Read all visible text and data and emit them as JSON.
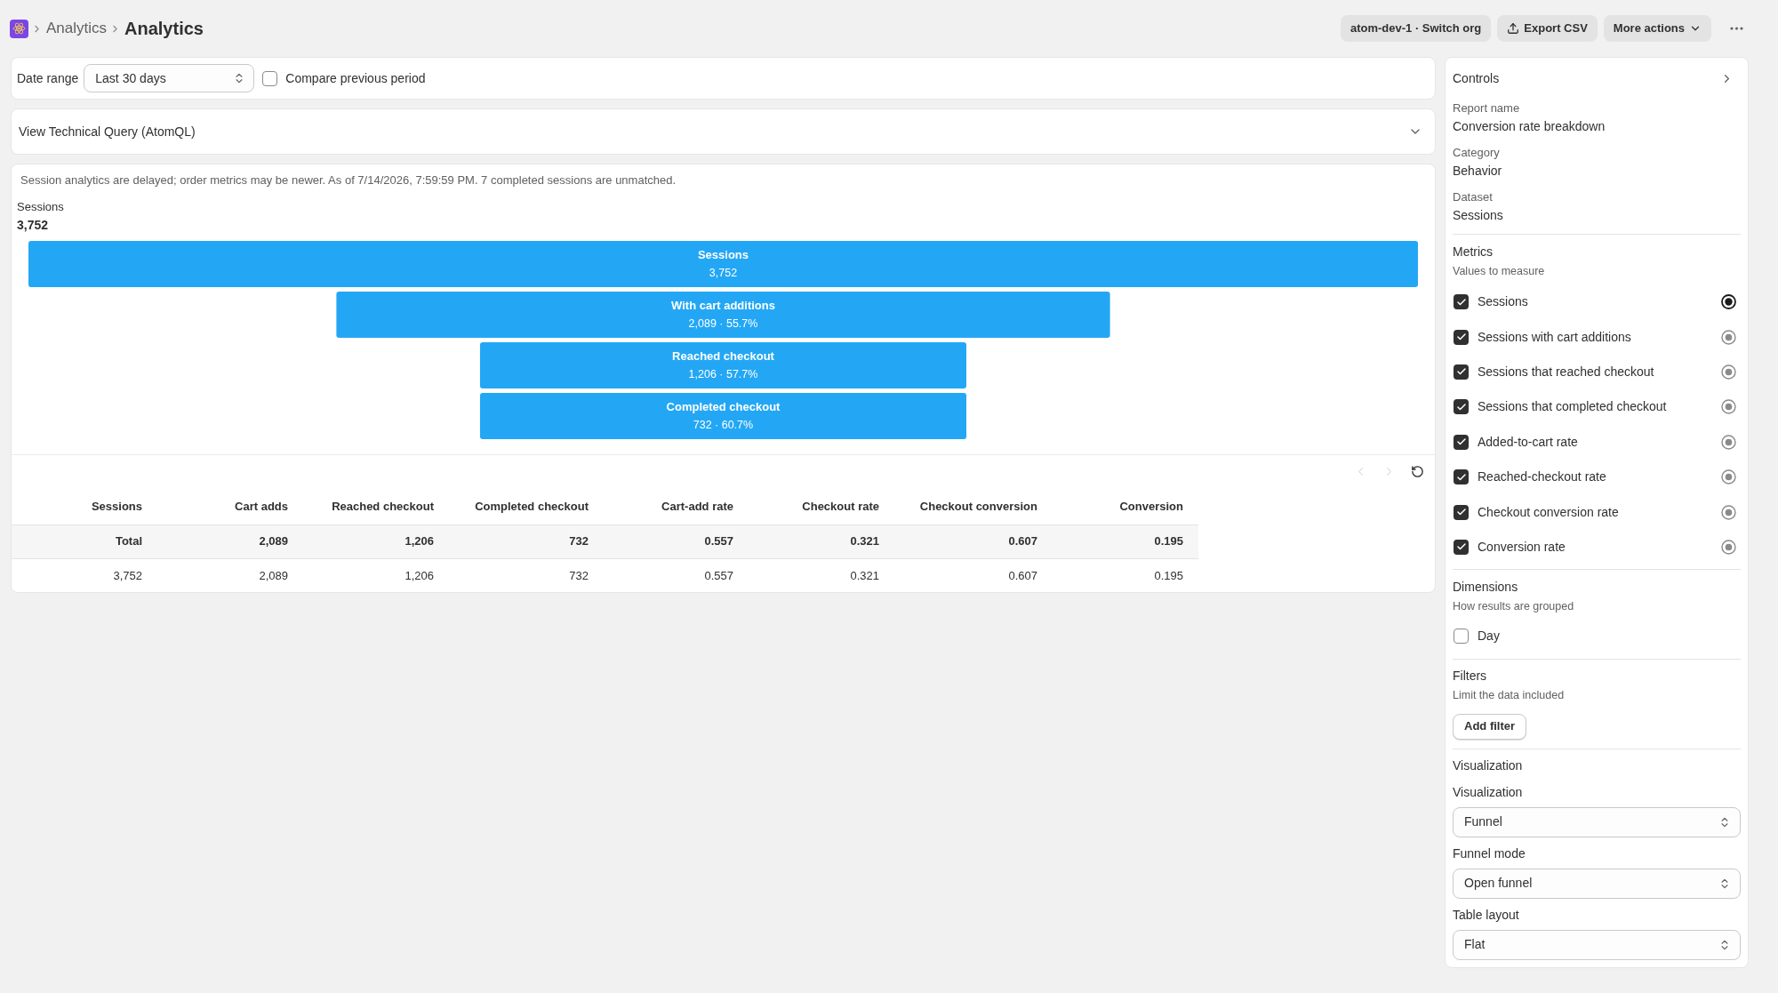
{
  "header": {
    "breadcrumbs": [
      "Analytics"
    ],
    "title": "Analytics",
    "actions": [
      {
        "label": "atom-dev-1 · Switch org",
        "kind": "plain"
      },
      {
        "label": "Export CSV",
        "kind": "export"
      },
      {
        "label": "More actions",
        "kind": "menu"
      }
    ]
  },
  "toolbar": {
    "date_range": {
      "label": "Date range",
      "value": "Last 30 days"
    },
    "compare": {
      "label": "Compare previous period",
      "checked": false
    }
  },
  "query": {
    "label": "View Technical Query (AtomQL)",
    "expanded": false
  },
  "report": {
    "notice": "Session analytics are delayed; order metrics may be newer. As of 7/14/2026, 7:59:59 PM. 7 completed sessions are unmatched.",
    "summary": {
      "label": "Sessions",
      "value": "3,752"
    },
    "chart_data": [
      {
        "type": "other",
        "categories": [
          "Sessions",
          "With cart additions",
          "Reached checkout",
          "Completed checkout"
        ],
        "values": [
          3752,
          2089,
          1206,
          732
        ],
        "value_labels": [
          "3,752",
          "2,089 · 55.7%",
          "1,206 · 57.7%",
          "732 · 60.7%"
        ],
        "color": "#23a7f5"
      }
    ],
    "pager": [
      {
        "kind": "previous",
        "disabled": true
      },
      {
        "kind": "next",
        "disabled": true
      },
      {
        "kind": "refresh",
        "disabled": false
      }
    ],
    "table": {
      "columns": [
        "Sessions",
        "Cart adds",
        "Reached checkout",
        "Completed checkout",
        "Cart-add rate",
        "Checkout rate",
        "Checkout conversion",
        "Conversion"
      ],
      "rows": [
        {
          "kind": "total",
          "cells": [
            "Total",
            "2,089",
            "1,206",
            "732",
            "0.557",
            "0.321",
            "0.607",
            "0.195"
          ]
        },
        {
          "kind": "data",
          "cells": [
            "3,752",
            "2,089",
            "1,206",
            "732",
            "0.557",
            "0.321",
            "0.607",
            "0.195"
          ]
        }
      ]
    }
  },
  "controls": {
    "title": "Controls",
    "fields": [
      {
        "label": "Report name",
        "value": "Conversion rate breakdown"
      },
      {
        "label": "Category",
        "value": "Behavior"
      },
      {
        "label": "Dataset",
        "value": "Sessions"
      }
    ],
    "metrics": {
      "title": "Metrics",
      "subtitle": "Values to measure",
      "items": [
        {
          "label": "Sessions",
          "checked": true,
          "selected": true
        },
        {
          "label": "Sessions with cart additions",
          "checked": true,
          "selected": false
        },
        {
          "label": "Sessions that reached checkout",
          "checked": true,
          "selected": false
        },
        {
          "label": "Sessions that completed checkout",
          "checked": true,
          "selected": false
        },
        {
          "label": "Added-to-cart rate",
          "checked": true,
          "selected": false
        },
        {
          "label": "Reached-checkout rate",
          "checked": true,
          "selected": false
        },
        {
          "label": "Checkout conversion rate",
          "checked": true,
          "selected": false
        },
        {
          "label": "Conversion rate",
          "checked": true,
          "selected": false
        }
      ]
    },
    "dimensions": {
      "title": "Dimensions",
      "subtitle": "How results are grouped",
      "items": [
        {
          "label": "Day",
          "checked": false
        }
      ]
    },
    "filters": {
      "title": "Filters",
      "subtitle": "Limit the data included",
      "button": "Add filter"
    },
    "visualization": {
      "title": "Visualization",
      "selects": [
        {
          "label": "Visualization",
          "value": "Funnel"
        },
        {
          "label": "Funnel mode",
          "value": "Open funnel"
        },
        {
          "label": "Table layout",
          "value": "Flat"
        }
      ]
    }
  }
}
